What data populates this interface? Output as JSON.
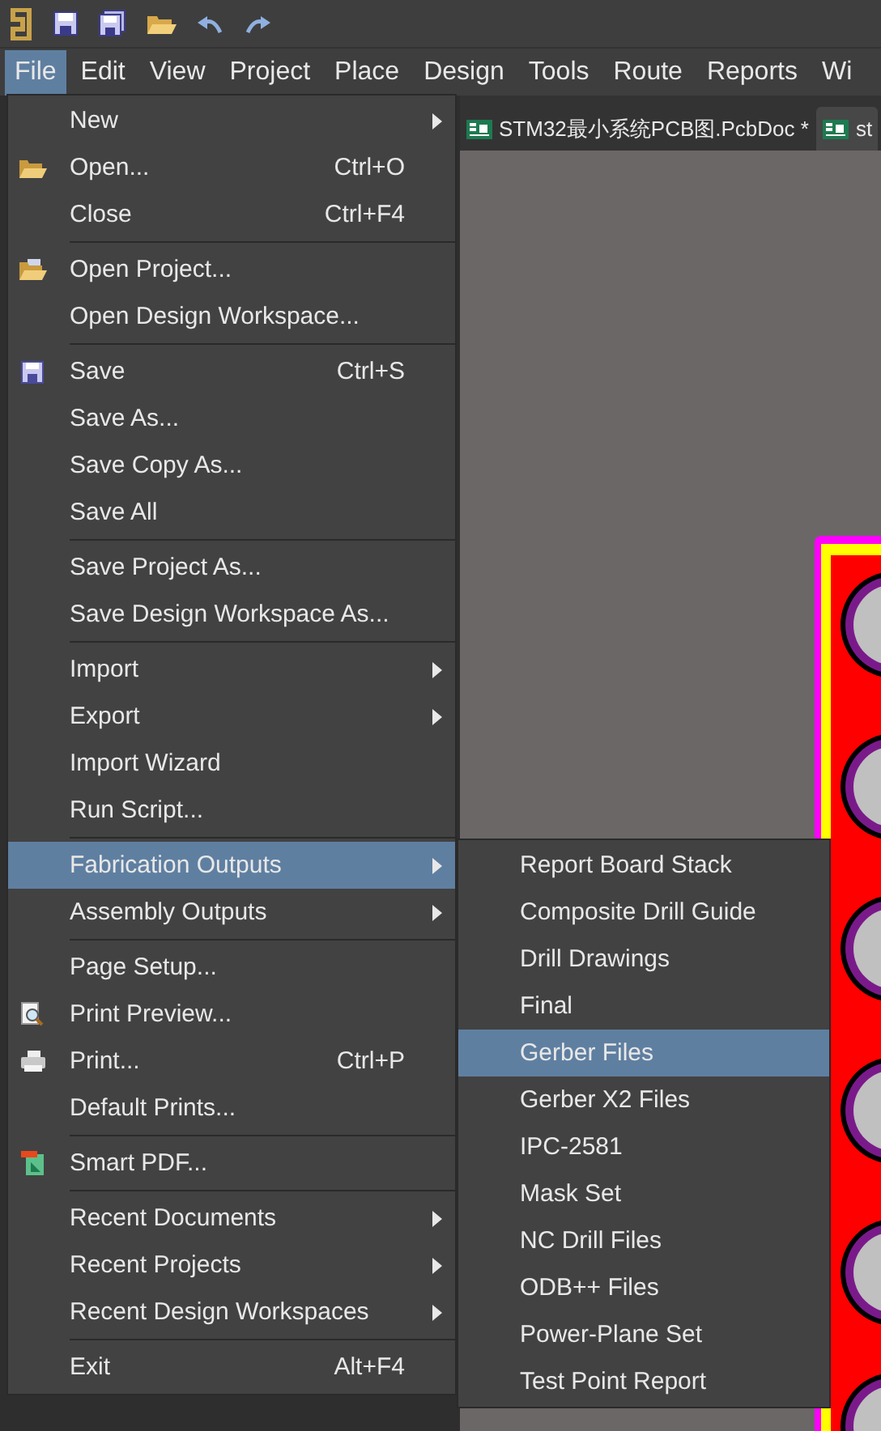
{
  "toolbar": {
    "buttons": [
      {
        "kind": "logo"
      },
      {
        "kind": "save"
      },
      {
        "kind": "save-all"
      },
      {
        "kind": "open"
      },
      {
        "kind": "undo"
      },
      {
        "kind": "redo"
      }
    ]
  },
  "menu_bar": [
    {
      "label": "File",
      "selected": true
    },
    {
      "label": "Edit",
      "selected": false
    },
    {
      "label": "View",
      "selected": false
    },
    {
      "label": "Project",
      "selected": false
    },
    {
      "label": "Place",
      "selected": false
    },
    {
      "label": "Design",
      "selected": false
    },
    {
      "label": "Tools",
      "selected": false
    },
    {
      "label": "Route",
      "selected": false
    },
    {
      "label": "Reports",
      "selected": false
    },
    {
      "label": "Wi",
      "selected": false
    }
  ],
  "tabs": [
    {
      "label": "STM32最小系统PCB图.PcbDoc *",
      "selected": false
    },
    {
      "label": "st",
      "selected": true
    }
  ],
  "file_menu": {
    "groups": [
      [
        {
          "label": "New",
          "submenu": true,
          "selected": false
        },
        {
          "label": "Open...",
          "kind": "folder",
          "shortcut": "Ctrl+O",
          "selected": false
        },
        {
          "label": "Close",
          "shortcut": "Ctrl+F4",
          "selected": false
        }
      ],
      [
        {
          "label": "Open Project...",
          "kind": "project",
          "selected": false
        },
        {
          "label": "Open Design Workspace...",
          "selected": false
        }
      ],
      [
        {
          "label": "Save",
          "kind": "save",
          "shortcut": "Ctrl+S",
          "selected": false
        },
        {
          "label": "Save As...",
          "selected": false
        },
        {
          "label": "Save Copy As...",
          "selected": false
        },
        {
          "label": "Save All",
          "selected": false
        }
      ],
      [
        {
          "label": "Save Project As...",
          "selected": false
        },
        {
          "label": "Save Design Workspace As...",
          "selected": false
        }
      ],
      [
        {
          "label": "Import",
          "submenu": true,
          "selected": false
        },
        {
          "label": "Export",
          "submenu": true,
          "selected": false
        },
        {
          "label": "Import Wizard",
          "selected": false
        },
        {
          "label": "Run Script...",
          "selected": false
        }
      ],
      [
        {
          "label": "Fabrication Outputs",
          "submenu": true,
          "selected": true
        },
        {
          "label": "Assembly Outputs",
          "submenu": true,
          "selected": false
        }
      ],
      [
        {
          "label": "Page Setup...",
          "selected": false
        },
        {
          "label": "Print Preview...",
          "kind": "preview",
          "selected": false
        },
        {
          "label": "Print...",
          "kind": "printer",
          "shortcut": "Ctrl+P",
          "selected": false
        },
        {
          "label": "Default Prints...",
          "selected": false
        }
      ],
      [
        {
          "label": "Smart PDF...",
          "kind": "pdf",
          "selected": false
        }
      ],
      [
        {
          "label": "Recent Documents",
          "submenu": true,
          "selected": false
        },
        {
          "label": "Recent Projects",
          "submenu": true,
          "selected": false
        },
        {
          "label": "Recent Design Workspaces",
          "submenu": true,
          "selected": false
        }
      ],
      [
        {
          "label": "Exit",
          "shortcut": "Alt+F4",
          "selected": false
        }
      ]
    ]
  },
  "fabrication_submenu": [
    {
      "label": "Report Board Stack",
      "selected": false
    },
    {
      "label": "Composite Drill Guide",
      "selected": false
    },
    {
      "label": "Drill Drawings",
      "selected": false
    },
    {
      "label": "Final",
      "selected": false
    },
    {
      "label": "Gerber Files",
      "selected": true
    },
    {
      "label": "Gerber X2 Files",
      "selected": false
    },
    {
      "label": "IPC-2581",
      "selected": false
    },
    {
      "label": "Mask Set",
      "selected": false
    },
    {
      "label": "NC Drill Files",
      "selected": false
    },
    {
      "label": "ODB++ Files",
      "selected": false
    },
    {
      "label": "Power-Plane Set",
      "selected": false
    },
    {
      "label": "Test Point Report",
      "selected": false
    }
  ]
}
